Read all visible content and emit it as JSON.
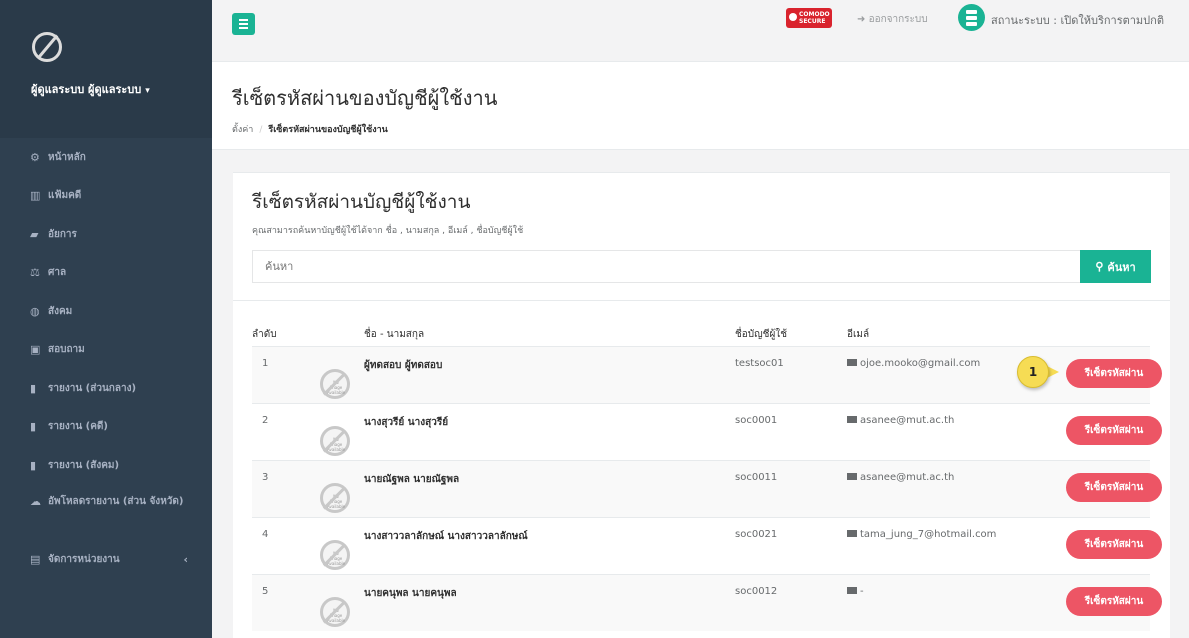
{
  "sidebar": {
    "profile_name": "ผู้ดูแลระบบ ผู้ดูแลระบบ",
    "items": [
      {
        "label": "หน้าหลัก",
        "icon": "dashboard-icon",
        "glyph": "⚙"
      },
      {
        "label": "แฟ้มคดี",
        "icon": "bank-icon",
        "glyph": "▥"
      },
      {
        "label": "อัยการ",
        "icon": "book-icon",
        "glyph": "▰"
      },
      {
        "label": "ศาล",
        "icon": "scale-icon",
        "glyph": "⚖"
      },
      {
        "label": "สังคม",
        "icon": "globe-icon",
        "glyph": "◍"
      },
      {
        "label": "สอบถาม",
        "icon": "question-icon",
        "glyph": "▣"
      },
      {
        "label": "รายงาน (ส่วนกลาง)",
        "icon": "bar-chart-icon",
        "glyph": "▮"
      },
      {
        "label": "รายงาน (คดี)",
        "icon": "bar-chart-icon",
        "glyph": "▮"
      },
      {
        "label": "รายงาน (สังคม)",
        "icon": "bar-chart-icon",
        "glyph": "▮"
      },
      {
        "label": "อัพโหลดรายงาน (ส่วน จังหวัด)",
        "icon": "cloud-upload-icon",
        "glyph": "☁"
      },
      {
        "label": "จัดการหน่วยงาน",
        "icon": "building-icon",
        "glyph": "▤"
      }
    ]
  },
  "topbar": {
    "comodo_line1": "COMODO",
    "comodo_line2": "SECURE",
    "logout_label": "ออกจากระบบ",
    "status_label": "สถานะระบบ : เปิดให้บริการตามปกติ"
  },
  "page": {
    "title": "รีเซ็ตรหัสผ่านของบัญชีผู้ใช้งาน",
    "breadcrumb_root": "ตั้งค่า",
    "breadcrumb_active": "รีเซ็ตรหัสผ่านของบัญชีผู้ใช้งาน"
  },
  "card": {
    "title": "รีเซ็ตรหัสผ่านบัญชีผู้ใช้งาน",
    "description": "คุณสามารถค้นหาบัญชีผู้ใช้ได้จาก ชื่อ , นามสกุล , อีเมล์ , ชื่อบัญชีผู้ใช้",
    "search_placeholder": "ค้นหา",
    "search_button": "ค้นหา"
  },
  "table": {
    "headers": {
      "order": "ลำดับ",
      "name": "ชื่อ - นามสกุล",
      "username": "ชื่อบัญชีผู้ใช้",
      "email": "อีเมล์"
    },
    "no_image_text": "No Image Available",
    "reset_label": "รีเซ็ตรหัสผ่าน",
    "rows": [
      {
        "order": "1",
        "name": "ผู้ทดสอบ ผู้ทดสอบ",
        "username": "testsoc01",
        "email": "ojoe.mooko@gmail.com"
      },
      {
        "order": "2",
        "name": "นางสุวรีย์ นางสุวรีย์",
        "username": "soc0001",
        "email": "asanee@mut.ac.th"
      },
      {
        "order": "3",
        "name": "นายณัฐพล นายณัฐพล",
        "username": "soc0011",
        "email": "asanee@mut.ac.th"
      },
      {
        "order": "4",
        "name": "นางสาววลาลักษณ์ นางสาววลาลักษณ์",
        "username": "soc0021",
        "email": "tama_jung_7@hotmail.com"
      },
      {
        "order": "5",
        "name": "นายคนุพล นายคนุพล",
        "username": "soc0012",
        "email": "-"
      }
    ]
  },
  "annotation": {
    "step_number": "1"
  }
}
